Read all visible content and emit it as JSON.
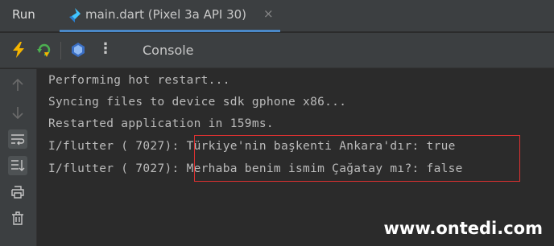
{
  "header": {
    "run_label": "Run",
    "tab": {
      "label": "main.dart (Pixel 3a API 30)",
      "close": "×",
      "icon": "dart-file-icon"
    }
  },
  "toolbar": {
    "hot_reload_icon": "lightning-icon",
    "hot_restart_icon": "hot-restart-icon",
    "devtools_icon": "dart-devtools-icon",
    "more_glyph": "⋮",
    "console_tab": "Console"
  },
  "sidebar": {
    "icons": [
      "arrow-up-icon",
      "arrow-down-icon",
      "soft-wrap-icon",
      "scroll-to-end-icon",
      "print-icon",
      "trash-icon"
    ]
  },
  "console": {
    "lines": [
      "Performing hot restart...",
      "Syncing files to device sdk gphone x86...",
      "Restarted application in 159ms.",
      "I/flutter ( 7027): Türkiye'nin başkenti Ankara'dır: true",
      "I/flutter ( 7027): Merhaba benim ismim Çağatay mı?: false"
    ]
  },
  "colors": {
    "background": "#2b2b2b",
    "panel": "#3c3f41",
    "text": "#bbbbbb",
    "tab_underline": "#4a88c7",
    "highlight_border": "#e03131"
  },
  "watermark": "www.ontedi.com"
}
